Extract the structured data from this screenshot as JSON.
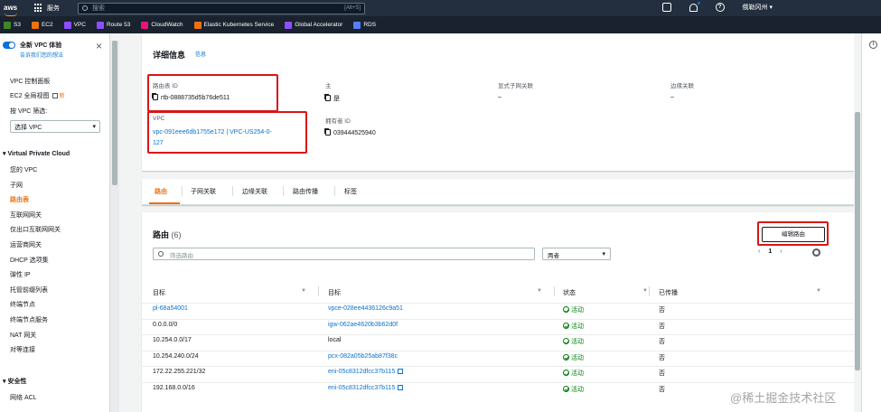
{
  "topbar": {
    "logo": "aws",
    "services_label": "服务",
    "search_placeholder": "搜索",
    "search_shortcut": "[Alt+S]",
    "region": "俄勒冈州 ▾"
  },
  "favorites": [
    {
      "label": "S3",
      "color": "#3f8624"
    },
    {
      "label": "EC2",
      "color": "#ec7211"
    },
    {
      "label": "VPC",
      "color": "#8c4fff"
    },
    {
      "label": "Route 53",
      "color": "#8c4fff"
    },
    {
      "label": "CloudWatch",
      "color": "#e7157b"
    },
    {
      "label": "Elastic Kubernetes Service",
      "color": "#ec7211"
    },
    {
      "label": "Global Accelerator",
      "color": "#8c4fff"
    },
    {
      "label": "RDS",
      "color": "#527fff"
    }
  ],
  "sidebar": {
    "new_experience_title": "全新 VPC 体验",
    "new_experience_link": "告诉我们您的想法",
    "dashboard": "VPC 控制面板",
    "ec2_global_view": "EC2 全局视图",
    "new_badge": "新",
    "filter_label": "按 VPC 筛选:",
    "filter_select": "选择 VPC",
    "section_vpc": "Virtual Private Cloud",
    "items": [
      "您的 VPC",
      "子网",
      "路由表",
      "互联网网关",
      "仅出口互联网网关",
      "运营商网关",
      "DHCP 选项集",
      "弹性 IP",
      "托管前缀列表",
      "终端节点",
      "终端节点服务",
      "NAT 网关",
      "对等连接"
    ],
    "section_security": "安全性",
    "security_items": [
      "网络 ACL"
    ]
  },
  "details": {
    "title": "详细信息",
    "info": "信息",
    "route_table_id_label": "路由表 ID",
    "route_table_id": "rtb-0888735d5b76de511",
    "main_label": "主",
    "main_value": "是",
    "explicit_subnet_label": "显式子网关联",
    "explicit_subnet_value": "–",
    "edge_assoc_label": "边缘关联",
    "edge_assoc_value": "–",
    "vpc_label": "VPC",
    "vpc_value_line1": "vpc-091eee6db1755e172 | VPC-US254-0-",
    "vpc_value_line2": "127",
    "owner_label": "拥有者 ID",
    "owner_value": "039444525940"
  },
  "tabs": [
    "路由",
    "子网关联",
    "边缘关联",
    "路由传播",
    "标签"
  ],
  "routes": {
    "title": "路由",
    "count": "(6)",
    "edit_button": "编辑路由",
    "filter_placeholder": "筛选路由",
    "dropdown": "两者",
    "page": "1",
    "columns": [
      "目标",
      "目标",
      "状态",
      "已传播"
    ],
    "rows": [
      {
        "destination": "pl-68a54001",
        "dest_link": true,
        "target": "vpce-028ee4436126c9a51",
        "target_ext": false,
        "status": "活动",
        "propagated": "否"
      },
      {
        "destination": "0.0.0.0/0",
        "dest_link": false,
        "target": "igw-062ae4620b3b62d0f",
        "target_ext": false,
        "status": "活动",
        "propagated": "否"
      },
      {
        "destination": "10.254.0.0/17",
        "dest_link": false,
        "target": "local",
        "target_ext": false,
        "status": "活动",
        "propagated": "否"
      },
      {
        "destination": "10.254.240.0/24",
        "dest_link": false,
        "target": "pcx-082a05b25ab87f38c",
        "target_ext": false,
        "status": "活动",
        "propagated": "否"
      },
      {
        "destination": "172.22.255.221/32",
        "dest_link": false,
        "target": "eni-05c8312dfcc37b115",
        "target_ext": true,
        "status": "活动",
        "propagated": "否"
      },
      {
        "destination": "192.168.0.0/16",
        "dest_link": false,
        "target": "eni-05c8312dfcc37b115",
        "target_ext": true,
        "status": "活动",
        "propagated": "否"
      }
    ]
  },
  "watermark": "@稀土掘金技术社区"
}
